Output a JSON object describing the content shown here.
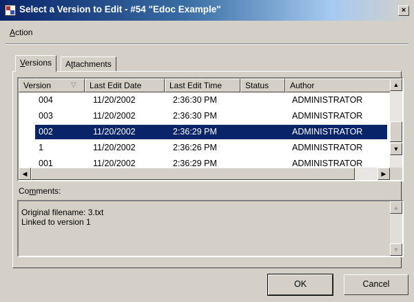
{
  "window": {
    "title": "Select a Version to Edit - #54 \"Edoc Example\"",
    "close_label": "×",
    "title_icon": "document-edit-icon"
  },
  "menu": {
    "items": [
      {
        "label": "Action",
        "mnemonic": "A",
        "rest": "ction"
      }
    ]
  },
  "tabs": [
    {
      "label": "Versions",
      "mnemonic": "V",
      "rest": "ersions",
      "active": true
    },
    {
      "label": "Attachments",
      "prefix": "A",
      "mnemonic": "t",
      "rest": "tachments",
      "active": false
    }
  ],
  "versions_table": {
    "columns": [
      "Version",
      "Last Edit Date",
      "Last Edit Time",
      "Status",
      "Author"
    ],
    "sort_indicator": "▽",
    "rows": [
      {
        "version": "004",
        "date": "11/20/2002",
        "time": "2:36:30 PM",
        "status": "",
        "author": "ADMINISTRATOR",
        "selected": false
      },
      {
        "version": "003",
        "date": "11/20/2002",
        "time": "2:36:30 PM",
        "status": "",
        "author": "ADMINISTRATOR",
        "selected": false
      },
      {
        "version": "002",
        "date": "11/20/2002",
        "time": "2:36:29 PM",
        "status": "",
        "author": "ADMINISTRATOR",
        "selected": true
      },
      {
        "version": "1",
        "date": "11/20/2002",
        "time": "2:36:26 PM",
        "status": "",
        "author": "ADMINISTRATOR",
        "selected": false
      },
      {
        "version": "001",
        "date": "11/20/2002",
        "time": "2:36:29 PM",
        "status": "",
        "author": "ADMINISTRATOR",
        "selected": false
      }
    ]
  },
  "comments": {
    "label": "Comments:",
    "label_prefix": "Co",
    "mnemonic": "m",
    "label_rest": "ments:",
    "lines": [
      "Original filename: 3.txt",
      "Linked to version 1"
    ]
  },
  "buttons": {
    "ok": "OK",
    "cancel": "Cancel"
  },
  "colors": {
    "selection": "#0a246a",
    "face": "#d4d0c8",
    "title_start": "#0a246a"
  }
}
